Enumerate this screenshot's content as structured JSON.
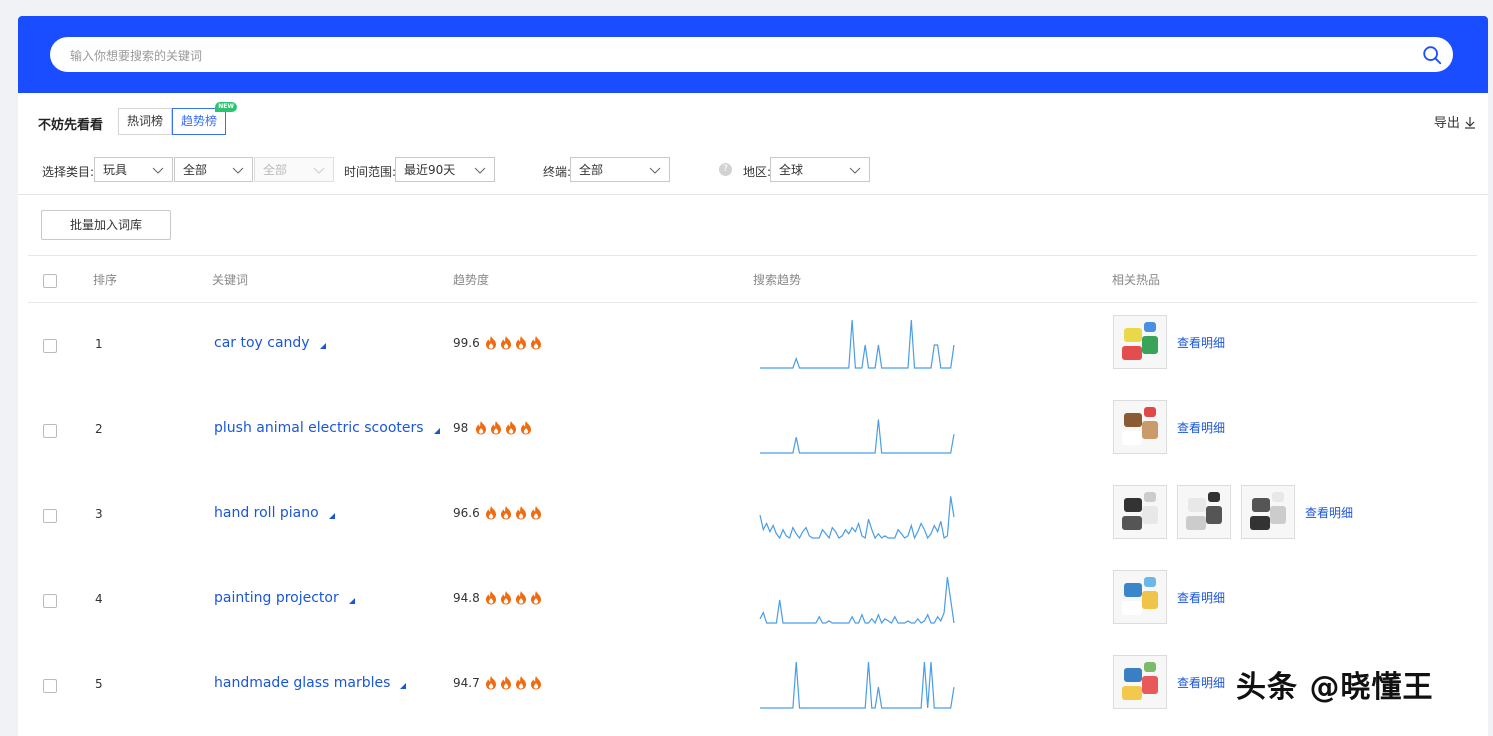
{
  "search": {
    "placeholder": "输入你想要搜索的关键词"
  },
  "header": {
    "title": "不妨先看看",
    "export_label": "导出"
  },
  "tabs": [
    {
      "label": "热词榜",
      "active": false
    },
    {
      "label": "趋势榜",
      "active": true,
      "badge": "NEW"
    }
  ],
  "filters": {
    "category_label": "选择类目:",
    "category_1": "玩具",
    "category_2": "全部",
    "category_3": "全部",
    "time_label": "时间范围:",
    "time_value": "最近90天",
    "terminal_label": "终端:",
    "terminal_value": "全部",
    "region_label": "地区:",
    "region_value": "全球"
  },
  "bulk_button": "批量加入词库",
  "table": {
    "headers": {
      "rank": "排序",
      "keyword": "关键词",
      "trend_score": "趋势度",
      "search_trend": "搜索趋势",
      "hot_products": "相关热品"
    },
    "detail_label": "查看明细",
    "rows": [
      {
        "rank": "1",
        "keyword": "car toy candy",
        "score": "99.6",
        "fires": 4,
        "thumbs": [
          "candy-toy-product"
        ],
        "trend": [
          0,
          0,
          0,
          0,
          0,
          0,
          0,
          0,
          0,
          0,
          0,
          9,
          0,
          0,
          0,
          0,
          0,
          0,
          0,
          0,
          0,
          0,
          0,
          0,
          0,
          0,
          0,
          0,
          46,
          0,
          0,
          0,
          22,
          0,
          0,
          0,
          22,
          0,
          0,
          0,
          0,
          0,
          0,
          0,
          0,
          0,
          46,
          0,
          0,
          0,
          0,
          0,
          0,
          22,
          22,
          0,
          0,
          0,
          0,
          22
        ]
      },
      {
        "rank": "2",
        "keyword": "plush animal electric scooters",
        "score": "98",
        "fires": 4,
        "thumbs": [
          "plush-dog-scooter-product"
        ],
        "trend": [
          0,
          0,
          0,
          0,
          0,
          0,
          0,
          0,
          0,
          0,
          0,
          15,
          0,
          0,
          0,
          0,
          0,
          0,
          0,
          0,
          0,
          0,
          0,
          0,
          0,
          0,
          0,
          0,
          0,
          0,
          0,
          0,
          0,
          0,
          0,
          0,
          32,
          0,
          0,
          0,
          0,
          0,
          0,
          0,
          0,
          0,
          0,
          0,
          0,
          0,
          0,
          0,
          0,
          0,
          0,
          0,
          0,
          0,
          0,
          18
        ]
      },
      {
        "rank": "3",
        "keyword": "hand roll piano",
        "score": "96.6",
        "fires": 4,
        "thumbs": [
          "roll-piano-product-1",
          "roll-piano-product-2",
          "roll-piano-product-3"
        ],
        "trend": [
          22,
          8,
          14,
          6,
          12,
          4,
          0,
          8,
          2,
          0,
          10,
          4,
          0,
          6,
          10,
          2,
          0,
          0,
          0,
          8,
          4,
          0,
          10,
          6,
          0,
          2,
          8,
          4,
          10,
          6,
          14,
          2,
          0,
          18,
          8,
          0,
          4,
          0,
          2,
          0,
          0,
          0,
          8,
          4,
          0,
          2,
          12,
          0,
          6,
          14,
          8,
          0,
          4,
          12,
          6,
          16,
          0,
          2,
          40,
          20
        ]
      },
      {
        "rank": "4",
        "keyword": "painting projector",
        "score": "94.8",
        "fires": 4,
        "thumbs": [
          "painting-projector-product"
        ],
        "trend": [
          4,
          10,
          0,
          0,
          0,
          0,
          22,
          0,
          0,
          0,
          0,
          0,
          0,
          0,
          0,
          0,
          0,
          0,
          6,
          0,
          0,
          2,
          0,
          0,
          0,
          0,
          0,
          0,
          6,
          0,
          0,
          8,
          0,
          0,
          4,
          0,
          8,
          0,
          4,
          2,
          0,
          6,
          0,
          0,
          0,
          2,
          0,
          0,
          4,
          0,
          2,
          8,
          0,
          0,
          6,
          2,
          10,
          44,
          22,
          0
        ]
      },
      {
        "rank": "5",
        "keyword": "handmade glass marbles",
        "score": "94.7",
        "fires": 4,
        "thumbs": [
          "glass-marbles-product"
        ],
        "trend": [
          0,
          0,
          0,
          0,
          0,
          0,
          0,
          0,
          0,
          0,
          0,
          44,
          0,
          0,
          0,
          0,
          0,
          0,
          0,
          0,
          0,
          0,
          0,
          0,
          0,
          0,
          0,
          0,
          0,
          0,
          0,
          0,
          0,
          44,
          0,
          0,
          20,
          0,
          0,
          0,
          0,
          0,
          0,
          0,
          0,
          0,
          0,
          0,
          0,
          0,
          44,
          0,
          44,
          0,
          0,
          0,
          0,
          0,
          0,
          20
        ]
      }
    ]
  },
  "colors": {
    "brand_blue": "#1a4dff",
    "link_blue": "#1a56db",
    "trend_line": "#4a9de6",
    "fire_orange": "#f06a0f",
    "badge_green": "#2cc56f"
  },
  "watermark": "头条 @晓懂王"
}
